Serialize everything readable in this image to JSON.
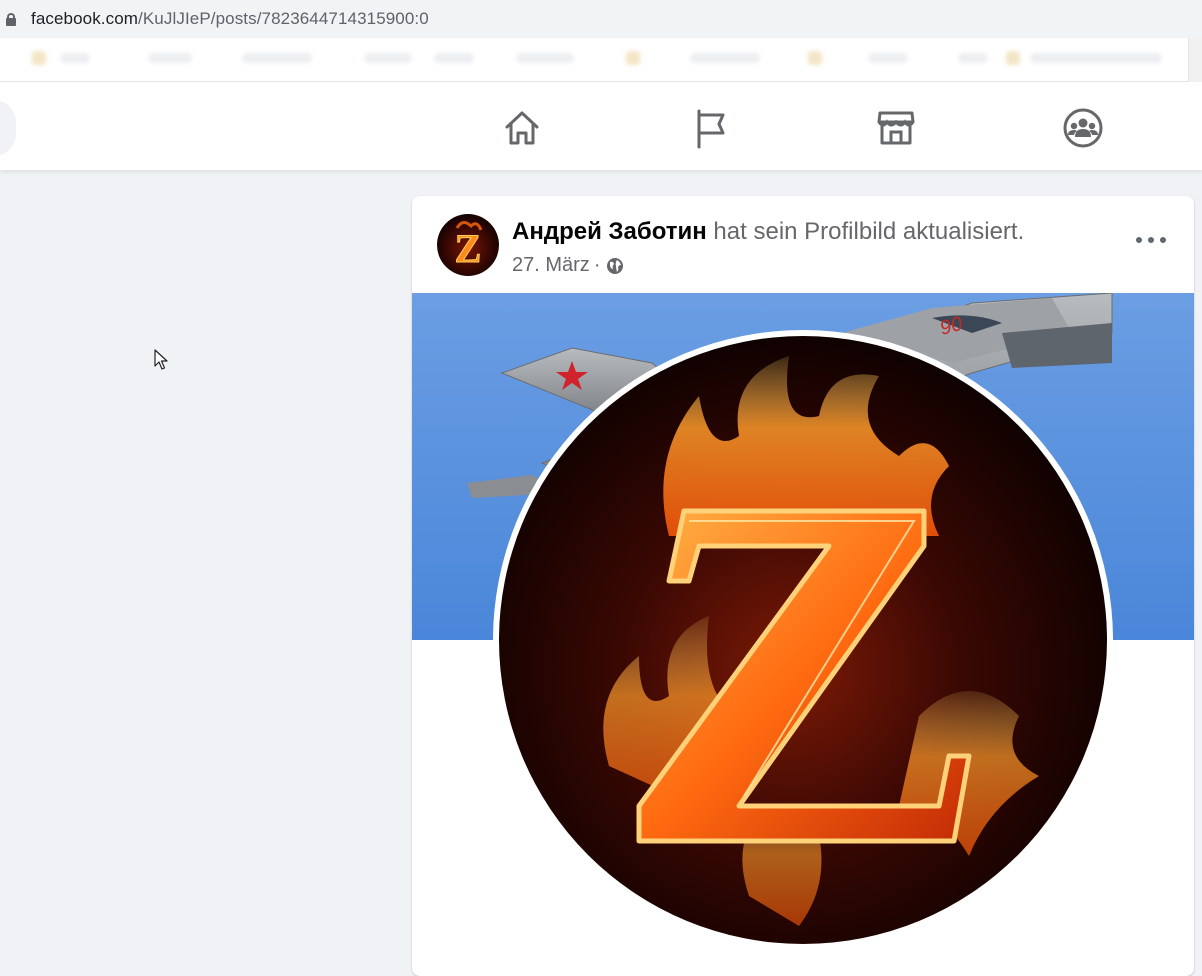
{
  "browser": {
    "url_domain": "facebook.com",
    "url_path": "/KuJlJIeP/posts/7823644714315900:0",
    "lock_icon": "lock-icon"
  },
  "fb_nav": {
    "tabs": [
      {
        "name": "tab-home",
        "icon": "home-icon"
      },
      {
        "name": "tab-pages",
        "icon": "flag-icon"
      },
      {
        "name": "tab-marketplace",
        "icon": "marketplace-icon"
      },
      {
        "name": "tab-groups",
        "icon": "groups-icon"
      }
    ],
    "icon_color": "#65676b"
  },
  "post": {
    "author": "Андрей Заботин",
    "action": " hat sein Profilbild aktualisiert.",
    "date": "27. März",
    "separator": "·",
    "privacy_icon": "globe-icon",
    "more_icon": "more-options-icon",
    "profile_picture": "flaming-letter-z",
    "cover_photo": "fighter-jet-in-blue-sky"
  },
  "colors": {
    "page_bg": "#f0f2f5",
    "text_primary": "#050505",
    "text_secondary": "#65676b",
    "sky": "#5a8fd8",
    "fire": "#ff7a1a"
  }
}
